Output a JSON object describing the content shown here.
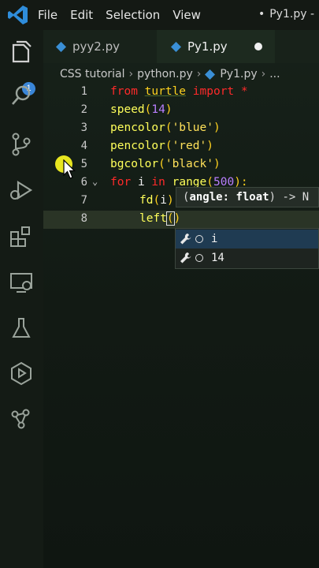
{
  "titlebar": {
    "menu": [
      "File",
      "Edit",
      "Selection",
      "View"
    ],
    "file_title": "Py1.py -"
  },
  "activity_bar": {
    "badge_count": "1",
    "icons": [
      "explorer-icon",
      "search-icon",
      "source-control-icon",
      "run-debug-icon",
      "extensions-icon",
      "remote-explorer-icon",
      "testing-icon",
      "deploy-icon",
      "graph-icon"
    ]
  },
  "tabs": [
    {
      "label": "pyy2.py",
      "active": false
    },
    {
      "label": "Py1.py",
      "active": true,
      "unsaved": true
    }
  ],
  "breadcrumb": [
    "CSS tutorial",
    "python.py",
    "Py1.py",
    "..."
  ],
  "editor": {
    "line_numbers": [
      "1",
      "2",
      "3",
      "4",
      "5",
      "6",
      "7",
      "8"
    ],
    "lines": [
      {
        "kw1": "from",
        "mod": "turtle",
        "kw2": "import",
        "star": "*"
      },
      {
        "fn": "speed",
        "open": "(",
        "num": "14",
        "close": ")"
      },
      {
        "fn": "pencolor",
        "open": "(",
        "str": "'blue'",
        "close": ")"
      },
      {
        "fn": "pencolor",
        "open": "(",
        "str": "'red'",
        "close": ")"
      },
      {
        "fn": "bgcolor",
        "open": "(",
        "str": "'black'",
        "close": ")"
      },
      {
        "kw1": "for",
        "var": "i",
        "kw2": "in",
        "fn": "range",
        "open": "(",
        "num": "500",
        "close": "):"
      },
      {
        "fn": "fd",
        "open": "(",
        "var": "i",
        "close": ")"
      },
      {
        "fn": "left",
        "open": "(",
        "close": ")"
      }
    ]
  },
  "signature_help": {
    "prefix": "(",
    "param": "angle: float",
    "suffix": ") -> N"
  },
  "suggestions": [
    {
      "label": "i",
      "selected": true
    },
    {
      "label": "14",
      "selected": false
    }
  ]
}
